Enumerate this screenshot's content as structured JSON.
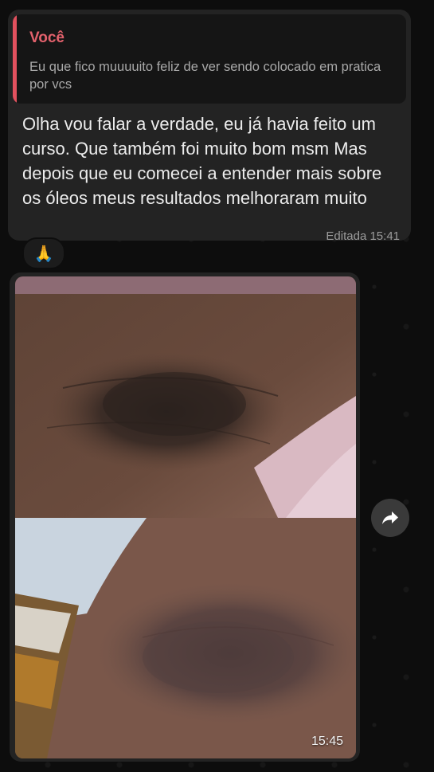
{
  "message": {
    "reply": {
      "author": "Você",
      "text": "Eu que fico muuuuito feliz de ver sendo colocado em pratica por vcs"
    },
    "text": "Olha vou falar a verdade, eu já havia feito um curso. Que também foi muito bom msm Mas depois que eu comecei a entender mais sobre os óleos meus resultados melhoraram muito",
    "meta": "Editada  15:41",
    "reaction": "🙏"
  },
  "image_message": {
    "time": "15:45"
  },
  "icons": {
    "forward": "forward-arrow-icon"
  },
  "colors": {
    "bubble": "#232323",
    "quote_bar": "#e2515e",
    "quote_author": "#e2616c",
    "background": "#0d0d0d"
  }
}
